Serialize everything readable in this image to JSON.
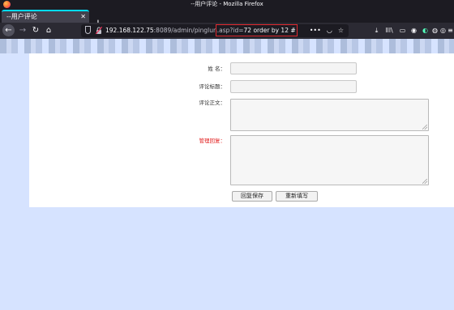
{
  "window": {
    "title": "--用户评论 - Mozilla Firefox"
  },
  "tab": {
    "label": "--用户评论",
    "close": "✕"
  },
  "newtab": {
    "label": "+"
  },
  "nav": {
    "back": "←",
    "forward": "→",
    "reload": "↻",
    "home": "⌂"
  },
  "url": {
    "host": "192.168.122.75",
    "rest": ":8089/admin/pinglun.asp?id=",
    "injected": "72 order by 12 #"
  },
  "url_actions": {
    "more": "•••",
    "pocket": "◡",
    "bookmark": "☆"
  },
  "toolbar": {
    "download": "⤓",
    "library": "lll\\",
    "sidebar": "▭",
    "account": "◉",
    "toggle": "◐",
    "ext1": "◍",
    "ext2": "◎",
    "menu": "≡"
  },
  "form": {
    "name_label": "姓  名：",
    "title_label": "评论标题：",
    "body_label": "评论正文：",
    "reply_label": "管理回复：",
    "save_button": "回复保存",
    "reset_button": "重新填写"
  },
  "colors": {
    "highlight": "#e0282e",
    "accent": "#00ddff",
    "reply_label": "#e21d1d"
  }
}
